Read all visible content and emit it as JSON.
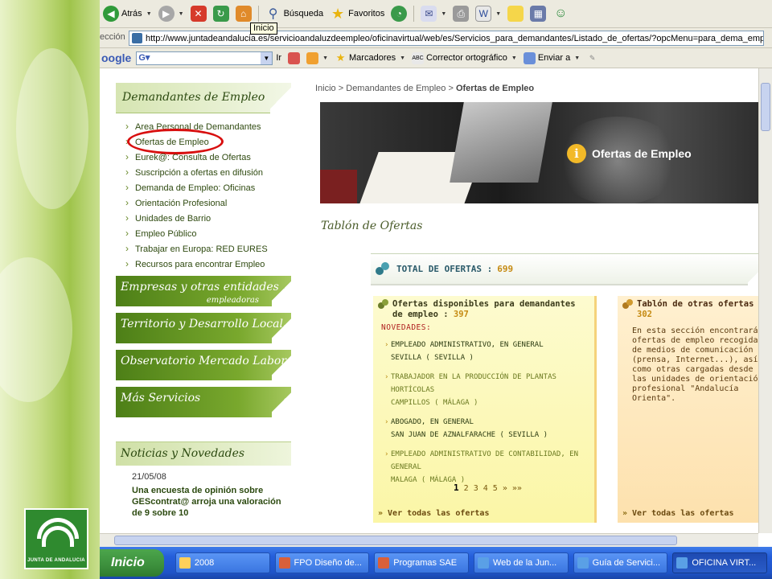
{
  "browser": {
    "toolbar": {
      "back": "Atrás",
      "search": "Búsqueda",
      "favorites": "Favoritos",
      "home_tooltip": "Inicio"
    },
    "address": {
      "label": "ección",
      "url": "http://www.juntadeandalucia.es/servicioandaluzdeempleo/oficinavirtual/web/es/Servicios_para_demandantes/Listado_de_ofertas/?opcMenu=para_dema_empl"
    },
    "google_bar": {
      "logo": "oogle",
      "go": "Ir",
      "bookmarks": "Marcadores",
      "spellcheck": "Corrector ortográfico",
      "send_to": "Enviar a"
    }
  },
  "sidebar": {
    "header": "Demandantes de Empleo",
    "items": [
      {
        "label": "Area Personal de Demandantes"
      },
      {
        "label": "Ofertas de Empleo"
      },
      {
        "label": "Eurek@: Consulta de Ofertas"
      },
      {
        "label": "Suscripción a ofertas en difusión"
      },
      {
        "label": "Demanda de Empleo: Oficinas"
      },
      {
        "label": "Orientación Profesional"
      },
      {
        "label": "Unidades de Barrio"
      },
      {
        "label": "Empleo Público"
      },
      {
        "label": "Trabajar en Europa: RED EURES"
      },
      {
        "label": "Recursos para encontrar Empleo"
      }
    ],
    "sections": [
      {
        "label": "Empresas y otras entidades",
        "sub": "empleadoras"
      },
      {
        "label": "Territorio y Desarrollo Local",
        "sub": ""
      },
      {
        "label": "Observatorio Mercado Laboral",
        "sub": ""
      },
      {
        "label": "Más Servicios",
        "sub": ""
      }
    ],
    "news": {
      "header": "Noticias y Novedades",
      "date": "21/05/08",
      "text": "Una encuesta de opinión sobre GEScontrat@ arroja una valoración de 9 sobre 10"
    }
  },
  "main": {
    "breadcrumb": {
      "home": "Inicio",
      "sep1": ">",
      "level1": "Demandantes de Empleo",
      "sep2": ">",
      "current": "Ofertas de Empleo"
    },
    "banner_title": "Ofertas de Empleo",
    "tablon_title": "Tablón de Ofertas",
    "total": {
      "label": "TOTAL DE OFERTAS :",
      "value": "699"
    },
    "available": {
      "title": "Ofertas disponibles para demandantes de empleo :",
      "count": "397",
      "novedades": "NOVEDADES:",
      "offers": [
        {
          "title": "EMPLEADO ADMINISTRATIVO, EN GENERAL",
          "location": "SEVILLA ( SEVILLA )"
        },
        {
          "title": "TRABAJADOR EN LA PRODUCCIÓN DE PLANTAS HORTÍCOLAS",
          "location": "CAMPILLOS ( MÁLAGA )"
        },
        {
          "title": "ABOGADO, EN GENERAL",
          "location": "SAN JUAN DE AZNALFARACHE ( SEVILLA )"
        },
        {
          "title": "EMPLEADO ADMINISTRATIVO DE CONTABILIDAD, EN GENERAL",
          "location": "MALAGA ( MÁLAGA )"
        }
      ],
      "pager": {
        "current": "1",
        "pages": "2 3 4 5",
        "next": "»",
        "last": "»»"
      },
      "footer": "Ver todas las ofertas"
    },
    "other": {
      "title": "Tablón de otras ofertas :",
      "count": "302",
      "description": "En esta sección encontrarás ofertas de empleo recogidas de medios de comunicación (prensa, Internet...), así como otras cargadas desde las unidades de orientación profesional \"Andalucía Orienta\".",
      "footer": "Ver todas las ofertas"
    }
  },
  "logo_text": "JUNTA DE ANDALUCIA",
  "taskbar": {
    "start": "Inicio",
    "tasks": [
      {
        "label": "2008"
      },
      {
        "label": "FPO Diseño de..."
      },
      {
        "label": "Programas SAE"
      },
      {
        "label": "Web de la Jun..."
      },
      {
        "label": "Guía de Servici..."
      },
      {
        "label": "OFICINA VIRT..."
      }
    ]
  },
  "colors": {
    "accent_green": "#6a9a24",
    "highlight_red": "#d80f0f",
    "count_orange": "#c58a12"
  }
}
